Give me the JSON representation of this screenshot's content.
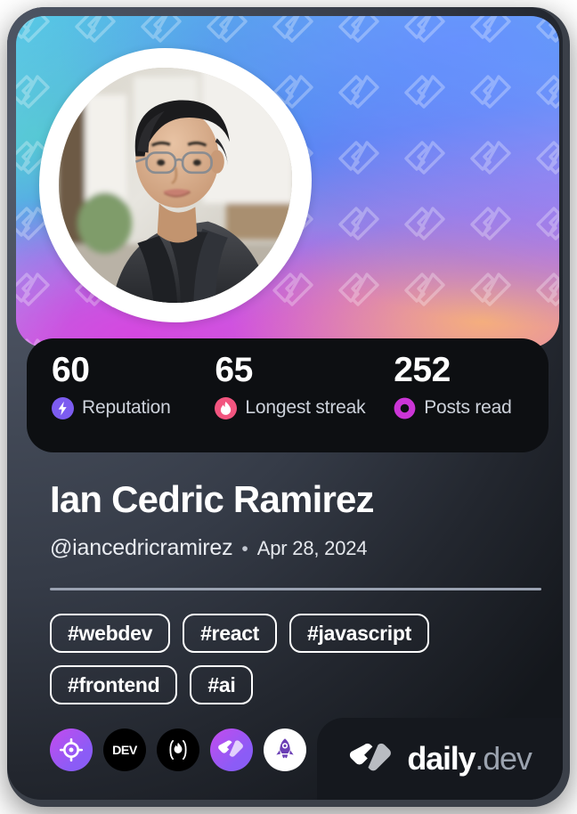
{
  "card": {
    "type": "devcard",
    "theme_colors": {
      "card_bg_light": "#545c6b",
      "card_bg_dark": "#14171c",
      "stats_bg": "#0d0f12",
      "brand_plate_bg": "#15181e",
      "accent_purple": "#8b5cf6",
      "accent_pink": "#f2557f",
      "accent_magenta": "#cb35d6",
      "divider": "#9aa2b1",
      "text_primary": "#ffffff",
      "text_secondary": "#cdd2db"
    }
  },
  "cover": {
    "watermark_icon": "daily-dev-chevron-pattern",
    "gradient": [
      "#3fa9d4",
      "#4f86ef",
      "#8f86e6",
      "#c468dd",
      "#f7b278"
    ]
  },
  "avatar": {
    "alt": "profile-photo",
    "frame_color": "#ffffff"
  },
  "stats": [
    {
      "value": "60",
      "label": "Reputation",
      "icon": "bolt-icon",
      "icon_color": "#7c5cf0"
    },
    {
      "value": "65",
      "label": "Longest streak",
      "icon": "flame-icon",
      "icon_color": "#f2557f"
    },
    {
      "value": "252",
      "label": "Posts read",
      "icon": "ring-icon",
      "icon_color": "#cb35d6"
    }
  ],
  "profile": {
    "name": "Ian Cedric Ramirez",
    "handle": "@iancedricramirez",
    "separator": "•",
    "joined_date": "Apr 28, 2024"
  },
  "tags": [
    {
      "label": "#webdev"
    },
    {
      "label": "#react"
    },
    {
      "label": "#javascript"
    },
    {
      "label": "#frontend"
    },
    {
      "label": "#ai"
    }
  ],
  "badges": [
    {
      "name": "crosshair-target-badge",
      "style": "badge-purple"
    },
    {
      "name": "dev-to-badge",
      "style": "badge-black"
    },
    {
      "name": "flame-parens-badge",
      "style": "badge-black"
    },
    {
      "name": "daily-dev-badge",
      "style": "badge-purple"
    },
    {
      "name": "rocket-badge",
      "style": "badge-white"
    }
  ],
  "brand": {
    "logo_icon": "daily-dev-logo",
    "name": "daily",
    "suffix": ".dev"
  }
}
